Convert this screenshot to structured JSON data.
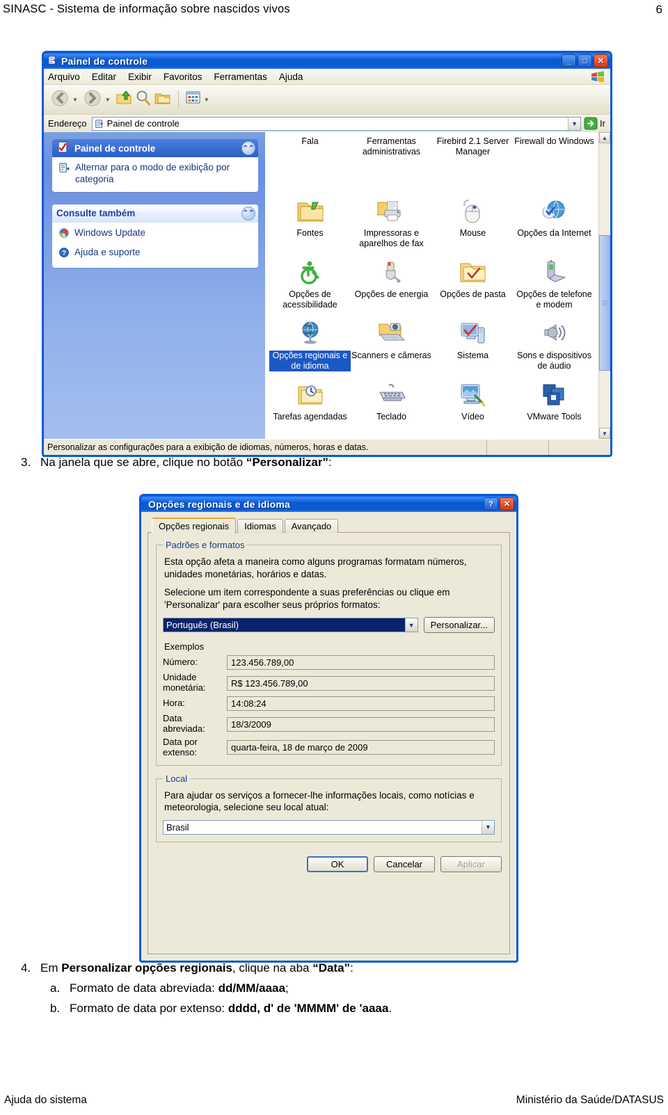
{
  "page": {
    "header_title": "SINASC - Sistema de informação sobre nascidos vivos",
    "page_number": "6",
    "footer_left": "Ajuda do sistema",
    "footer_right": "Ministério da Saúde/DATASUS"
  },
  "steps": {
    "step3": {
      "num": "3.",
      "text_before": "Na janela que se abre, clique no botão ",
      "bold": "“Personalizar”",
      "text_after": ":"
    },
    "step4": {
      "num": "4.",
      "text_1": "Em ",
      "bold_1": "Personalizar opções regionais",
      "text_2": ", clique na aba ",
      "bold_2": "“Data”",
      "text_3": ":"
    },
    "step4a": {
      "num": "a.",
      "text": "Formato de data abreviada: ",
      "bold": "dd/MM/aaaa",
      "tail": ";"
    },
    "step4b": {
      "num": "b.",
      "text": "Formato de data por extenso: ",
      "bold": "dddd, d' de 'MMMM' de 'aaaa",
      "tail": "."
    }
  },
  "control_panel": {
    "title": "Painel de controle",
    "window_buttons": {
      "minimize": "_",
      "maximize": "□",
      "close": "✕"
    },
    "menu": [
      "Arquivo",
      "Editar",
      "Exibir",
      "Favoritos",
      "Ferramentas",
      "Ajuda"
    ],
    "toolbar": {
      "back": "back-arrow",
      "forward": "forward-arrow",
      "up": "up-folder",
      "search": "search",
      "folders": "folders",
      "views": "views"
    },
    "address": {
      "label": "Endereço",
      "value": "Painel de controle",
      "go": "Ir"
    },
    "sidebar": {
      "panel1": {
        "title": "Painel de controle",
        "link": "Alternar para o modo de exibição por categoria"
      },
      "panel2": {
        "title": "Consulte também",
        "links": [
          "Windows Update",
          "Ajuda e suporte"
        ]
      }
    },
    "icons": [
      {
        "name": "Fala",
        "clipped": true
      },
      {
        "name": "Ferramentas administrativas",
        "clipped": true
      },
      {
        "name": "Firebird 2.1 Server Manager",
        "clipped": true
      },
      {
        "name": "Firewall do Windows",
        "clipped": true
      },
      {
        "name": "Fontes",
        "icon": "folder-fonts"
      },
      {
        "name": "Impressoras e aparelhos de fax",
        "icon": "printer"
      },
      {
        "name": "Mouse",
        "icon": "mouse"
      },
      {
        "name": "Opções da Internet",
        "icon": "internet-globe"
      },
      {
        "name": "Opções de acessibilidade",
        "icon": "accessibility"
      },
      {
        "name": "Opções de energia",
        "icon": "power-plug"
      },
      {
        "name": "Opções de pasta",
        "icon": "folder-check"
      },
      {
        "name": "Opções de telefone e modem",
        "icon": "phone-modem"
      },
      {
        "name": "Opções regionais e de idioma",
        "icon": "globe-regional",
        "selected": true
      },
      {
        "name": "Scanners e câmeras",
        "icon": "scanner-camera"
      },
      {
        "name": "Sistema",
        "icon": "computer-check"
      },
      {
        "name": "Sons e dispositivos de áudio",
        "icon": "speaker"
      },
      {
        "name": "Tarefas agendadas",
        "icon": "folder-clock"
      },
      {
        "name": "Teclado",
        "icon": "keyboard"
      },
      {
        "name": "Vídeo",
        "icon": "display"
      },
      {
        "name": "VMware Tools",
        "icon": "vmware"
      }
    ],
    "status": "Personalizar as configurações para a exibição de idiomas, números, horas e datas."
  },
  "dialog": {
    "title": "Opções regionais e de idioma",
    "window_buttons": {
      "help": "?",
      "close": "✕"
    },
    "tabs": [
      {
        "label": "Opções regionais",
        "active": true
      },
      {
        "label": "Idiomas",
        "active": false
      },
      {
        "label": "Avançado",
        "active": false
      }
    ],
    "standards_group": {
      "legend": "Padrões e formatos",
      "paragraph1": "Esta opção afeta a maneira como alguns programas formatam números, unidades monetárias, horários e datas.",
      "paragraph2": "Selecione um item correspondente a suas preferências ou clique em 'Personalizar' para escolher seus próprios formatos:",
      "locale_value": "Português (Brasil)",
      "customize_button": "Personalizar..."
    },
    "samples": {
      "label": "Exemplos",
      "rows": [
        {
          "key": "Número:",
          "value": "123.456.789,00"
        },
        {
          "key": "Unidade monetária:",
          "value": "R$ 123.456.789,00"
        },
        {
          "key": "Hora:",
          "value": "14:08:24"
        },
        {
          "key": "Data abreviada:",
          "value": "18/3/2009"
        },
        {
          "key": "Data por extenso:",
          "value": "quarta-feira, 18 de março de 2009"
        }
      ]
    },
    "location_group": {
      "legend": "Local",
      "paragraph": "Para ajudar os serviços a fornecer-lhe informações locais, como notícias e meteorologia, selecione seu local atual:",
      "value": "Brasil"
    },
    "buttons": {
      "ok": "OK",
      "cancel": "Cancelar",
      "apply": "Aplicar",
      "apply_disabled": true
    }
  },
  "colors": {
    "xp_blue": "#0a5ad4",
    "xp_beige": "#ece9d8",
    "selection_blue": "#1b58c4",
    "link_blue": "#16387f"
  }
}
